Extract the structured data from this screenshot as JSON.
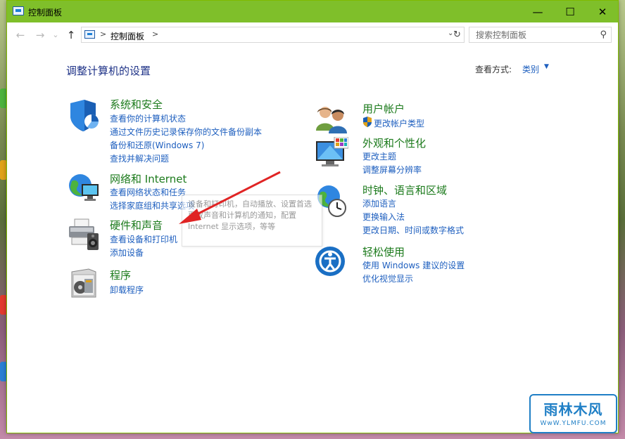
{
  "window": {
    "title": "控制面板",
    "minimize": "—",
    "maximize": "☐",
    "close": "✕"
  },
  "addressbar": {
    "back": "←",
    "forward": "→",
    "recent": "⌄",
    "up": "↑",
    "path": "控制面板",
    "separator": ">",
    "dropdown": "⌄",
    "refresh": "↻",
    "search_placeholder": "搜索控制面板",
    "search_glyph": "⚲"
  },
  "content": {
    "heading": "调整计算机的设置",
    "viewby_label": "查看方式:",
    "viewby_value": "类别",
    "viewby_caret": "▼",
    "categories": [
      {
        "title": "系统和安全",
        "links": [
          "查看你的计算机状态",
          "通过文件历史记录保存你的文件备份副本",
          "备份和还原(Windows 7)",
          "查找并解决问题"
        ]
      },
      {
        "title": "网络和 Internet",
        "links": [
          "查看网络状态和任务",
          "选择家庭组和共享选项"
        ]
      },
      {
        "title": "硬件和声音",
        "links": [
          "查看设备和打印机",
          "添加设备"
        ]
      },
      {
        "title": "程序",
        "links": [
          "卸载程序"
        ]
      },
      {
        "title": "用户帐户",
        "links": [
          "更改帐户类型"
        ]
      },
      {
        "title": "外观和个性化",
        "links": [
          "更改主题",
          "调整屏幕分辨率"
        ]
      },
      {
        "title": "时钟、语言和区域",
        "links": [
          "添加语言",
          "更换输入法",
          "更改日期、时间或数字格式"
        ]
      },
      {
        "title": "轻松使用",
        "links": [
          "使用 Windows 建议的设置",
          "优化视觉显示"
        ]
      }
    ]
  },
  "tooltip": {
    "lines": [
      "设备和打印机，自动播放、设置首选",
      "更改声音和计算机的通知，配置",
      "Internet 显示选项，等等"
    ]
  },
  "watermark": {
    "main": "雨林木风",
    "sub": "WwW.YLMFU.COM"
  },
  "colors": {
    "titlebar": "#7fbf2a",
    "category_title": "#1b7a1b",
    "link": "#1e5fbf",
    "heading": "#1e3287"
  }
}
